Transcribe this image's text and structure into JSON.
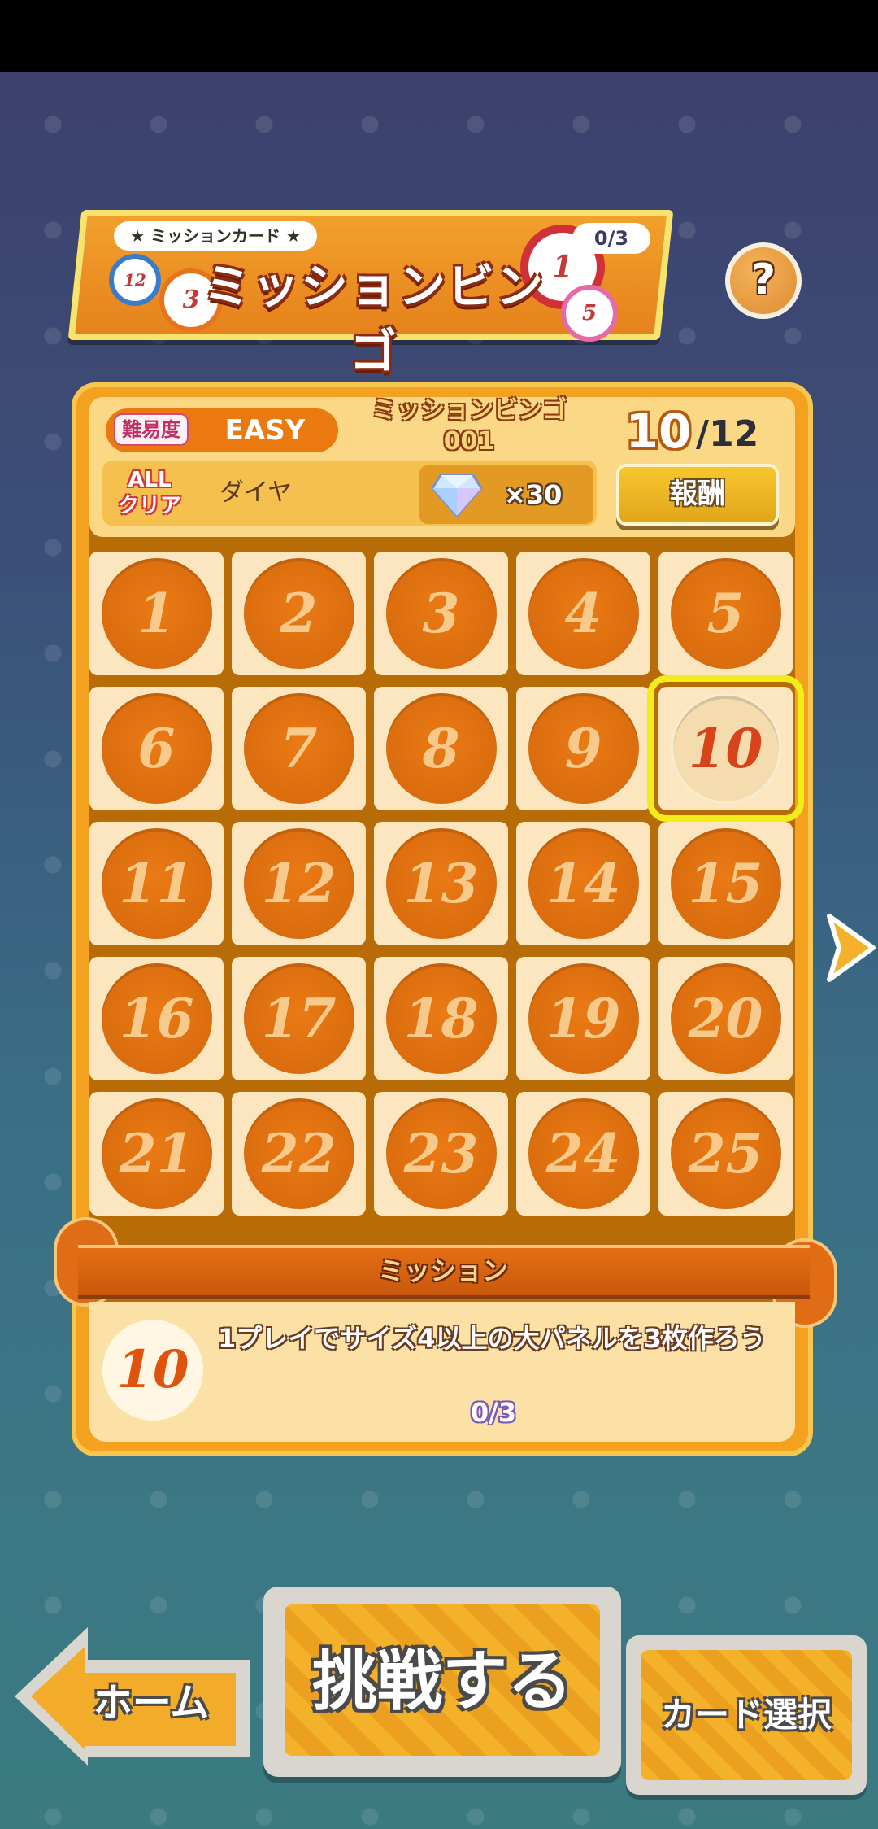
{
  "title": {
    "subtitle": "★ ミッションカード ★",
    "main": "ミッションビンゴ",
    "progress": "0/3"
  },
  "help": {
    "label": "?"
  },
  "board": {
    "difficulty_label": "難易度",
    "difficulty_value": "EASY",
    "bingo_name": "ミッションビンゴ\n001",
    "current": "10",
    "total": "/12",
    "all_clear": "ALL\nクリア",
    "reward_name": "ダイヤ",
    "reward_qty": "×30",
    "reward_button": "報酬"
  },
  "cells": [
    "1",
    "2",
    "3",
    "4",
    "5",
    "6",
    "7",
    "8",
    "9",
    "10",
    "11",
    "12",
    "13",
    "14",
    "15",
    "16",
    "17",
    "18",
    "19",
    "20",
    "21",
    "22",
    "23",
    "24",
    "25"
  ],
  "selected_cell": "10",
  "mission": {
    "title": "ミッション",
    "number": "10",
    "text": "1プレイでサイズ4以上の大パネルを3枚作ろう",
    "progress": "0/3"
  },
  "buttons": {
    "home": "ホーム",
    "challenge": "挑戦する",
    "card_select": "カード選択"
  },
  "colors": {
    "accent_orange": "#ea7a14",
    "highlight_yellow": "#f2ec1a",
    "panel_cream": "#fbe6bf"
  }
}
